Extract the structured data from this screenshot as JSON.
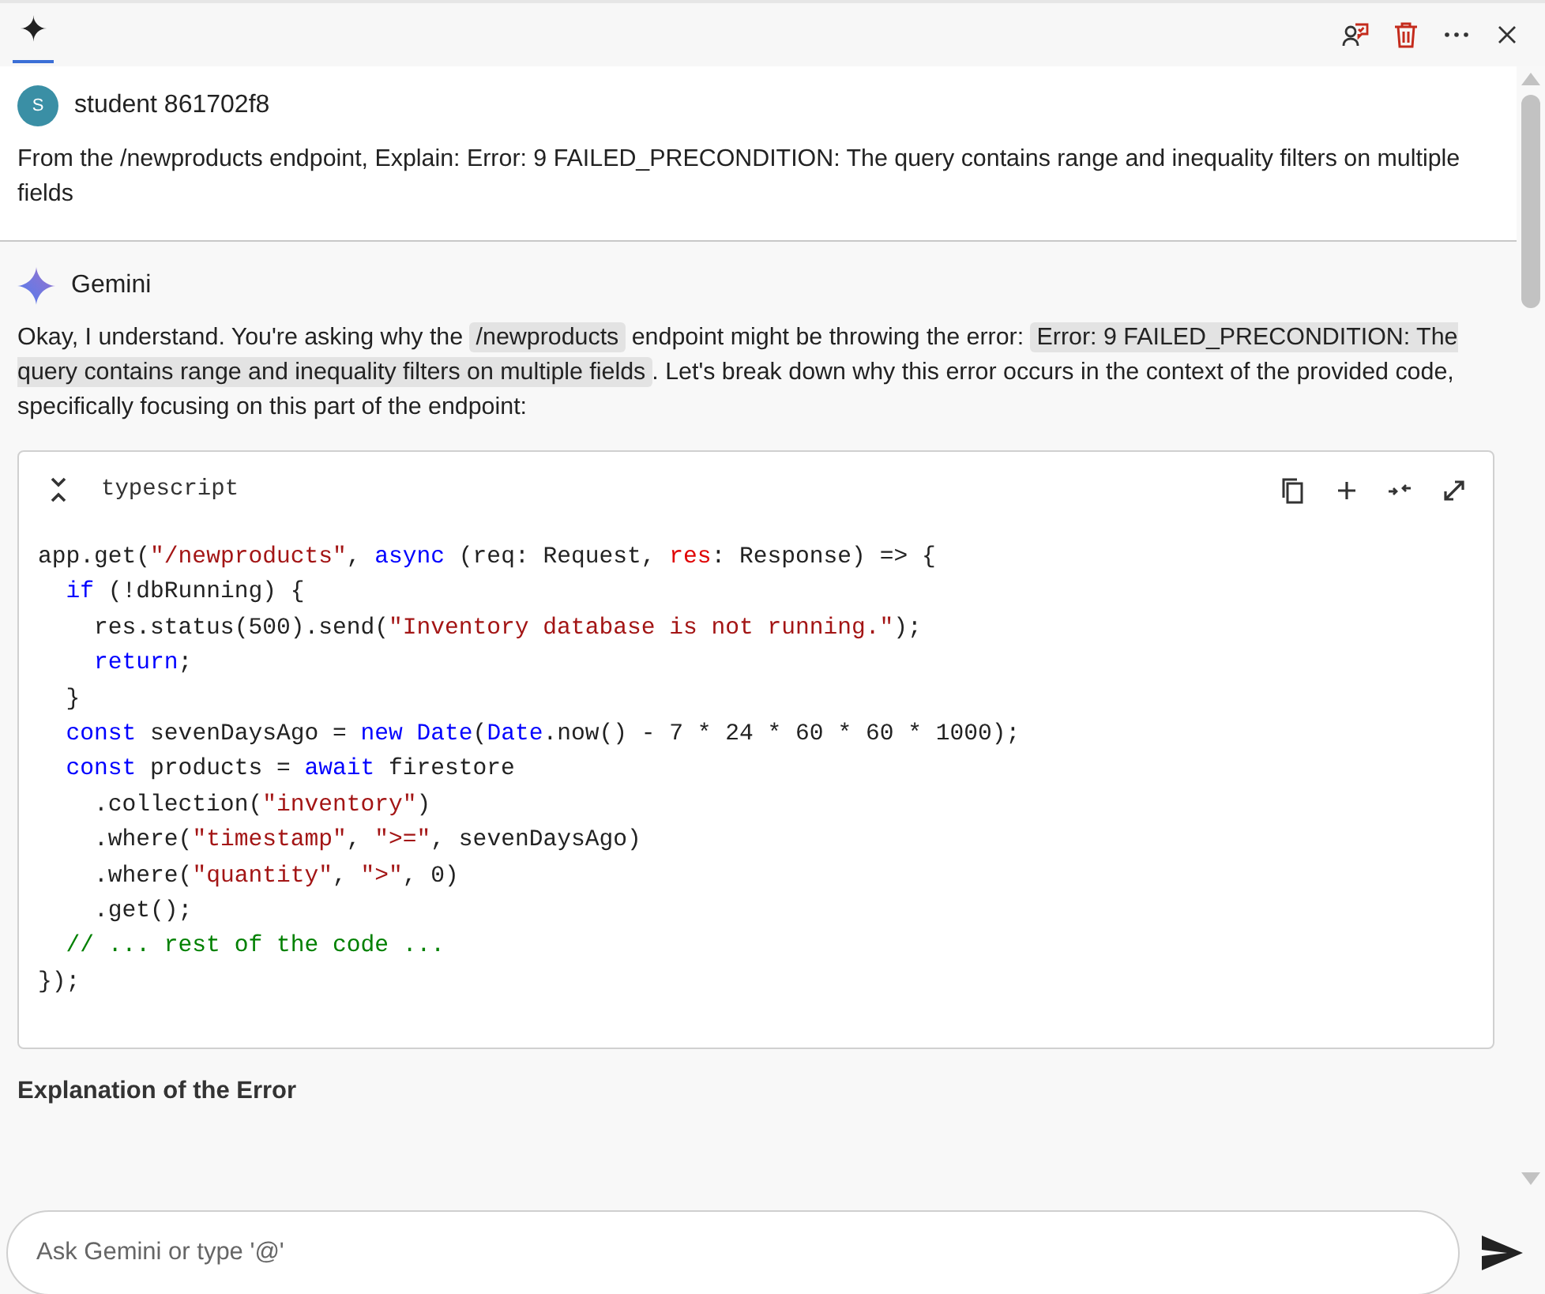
{
  "toolbar": {
    "tabs": [
      {
        "label": "✦",
        "selected": true
      }
    ],
    "actions": [
      {
        "kind": "feedback"
      },
      {
        "kind": "delete"
      },
      {
        "kind": "more"
      },
      {
        "kind": "close"
      }
    ]
  },
  "user_message": {
    "avatar": "S",
    "name": "student 861702f8",
    "text": "From the /newproducts endpoint, Explain: Error: 9 FAILED_PRECONDITION: The query contains range and inequality filters on multiple fields"
  },
  "response": {
    "name": "Gemini",
    "intro": [
      {
        "kind": "text",
        "text": "Okay, I understand. You're asking why the "
      },
      {
        "kind": "code",
        "text": "/newproducts"
      },
      {
        "kind": "text",
        "text": " endpoint might be throwing the error: "
      },
      {
        "kind": "code",
        "text": "Error: 9 FAILED_PRECONDITION: The query contains range and inequality filters on multiple fields"
      },
      {
        "kind": "text",
        "text": ". Let's break down why this error occurs in the context of the provided code, specifically focusing on this part of the endpoint:"
      }
    ],
    "code_block": {
      "language": "typescript",
      "actions": [
        {
          "kind": "copy"
        },
        {
          "kind": "insert"
        },
        {
          "kind": "collapse"
        },
        {
          "kind": "expand"
        }
      ],
      "lines": [
        [
          {
            "kind": "plain",
            "text": "app.get("
          },
          {
            "kind": "string",
            "text": "\"/newproducts\""
          },
          {
            "kind": "plain",
            "text": ", "
          },
          {
            "kind": "keyword",
            "text": "async"
          },
          {
            "kind": "plain",
            "text": " (req: Request, "
          },
          {
            "kind": "param",
            "text": "res"
          },
          {
            "kind": "plain",
            "text": ": Response) => {"
          }
        ],
        [
          {
            "kind": "keyword",
            "text": "  if"
          },
          {
            "kind": "plain",
            "text": " (!dbRunning) {"
          }
        ],
        [
          {
            "kind": "plain",
            "text": "    res.status(500).send("
          },
          {
            "kind": "string",
            "text": "\"Inventory database is not running.\""
          },
          {
            "kind": "plain",
            "text": ");"
          }
        ],
        [
          {
            "kind": "keyword",
            "text": "    return"
          },
          {
            "kind": "plain",
            "text": ";"
          }
        ],
        [
          {
            "kind": "plain",
            "text": "  }"
          }
        ],
        [
          {
            "kind": "keyword",
            "text": "  const"
          },
          {
            "kind": "plain",
            "text": " sevenDaysAgo = "
          },
          {
            "kind": "keyword",
            "text": "new Date"
          },
          {
            "kind": "plain",
            "text": "("
          },
          {
            "kind": "keyword",
            "text": "Date"
          },
          {
            "kind": "plain",
            "text": ".now() - 7 * 24 * 60 * 60 * 1000);"
          }
        ],
        [
          {
            "kind": "keyword",
            "text": "  const"
          },
          {
            "kind": "plain",
            "text": " products = "
          },
          {
            "kind": "keyword",
            "text": "await"
          },
          {
            "kind": "plain",
            "text": " firestore"
          }
        ],
        [
          {
            "kind": "plain",
            "text": "    .collection("
          },
          {
            "kind": "string",
            "text": "\"inventory\""
          },
          {
            "kind": "plain",
            "text": ")"
          }
        ],
        [
          {
            "kind": "plain",
            "text": "    .where("
          },
          {
            "kind": "string",
            "text": "\"timestamp\""
          },
          {
            "kind": "plain",
            "text": ", "
          },
          {
            "kind": "string",
            "text": "\">=\""
          },
          {
            "kind": "plain",
            "text": ", sevenDaysAgo)"
          }
        ],
        [
          {
            "kind": "plain",
            "text": "    .where("
          },
          {
            "kind": "string",
            "text": "\"quantity\""
          },
          {
            "kind": "plain",
            "text": ", "
          },
          {
            "kind": "string",
            "text": "\">\""
          },
          {
            "kind": "plain",
            "text": ", 0)"
          }
        ],
        [
          {
            "kind": "plain",
            "text": "    .get();"
          }
        ],
        [
          {
            "kind": "comment",
            "text": "  // ... rest of the code ..."
          }
        ],
        [
          {
            "kind": "plain",
            "text": "});"
          }
        ]
      ]
    },
    "heading": "Explanation of the Error"
  },
  "composer": {
    "placeholder": "Ask Gemini or type '@'"
  }
}
